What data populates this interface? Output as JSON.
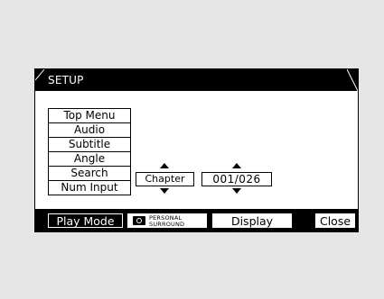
{
  "title": "SETUP",
  "menu": {
    "items": [
      "Top Menu",
      "Audio",
      "Subtitle",
      "Angle",
      "Search",
      "Num Input"
    ]
  },
  "spinners": {
    "left": {
      "value": "Chapter"
    },
    "right": {
      "value": "001/026"
    }
  },
  "bottom": {
    "play_mode": "Play Mode",
    "personal_surround_line1": "PERSONAL",
    "personal_surround_line2": "SURROUND",
    "display": "Display",
    "close": "Close"
  },
  "icons": {
    "up": "arrow-up-icon",
    "down": "arrow-down-icon",
    "surround": "personal-surround-icon"
  }
}
